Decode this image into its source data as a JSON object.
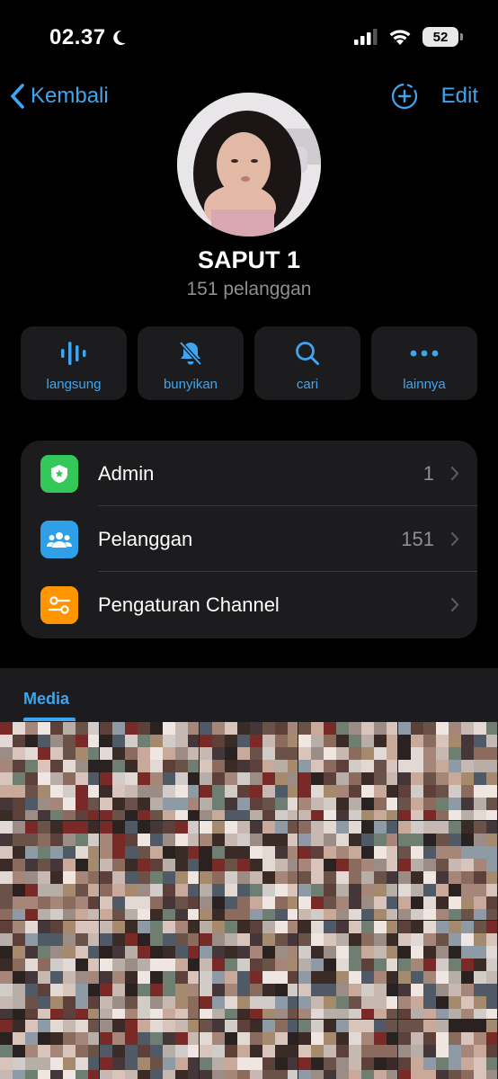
{
  "status_bar": {
    "time": "02.37",
    "moon_icon": "moon-icon",
    "battery": "52"
  },
  "nav": {
    "back_label": "Kembali",
    "edit_label": "Edit",
    "add_icon": "plus-circle-icon"
  },
  "profile": {
    "name": "SAPUT 1",
    "subscribers": "151 pelanggan"
  },
  "actions": [
    {
      "label": "langsung",
      "icon": "live-waveform-icon"
    },
    {
      "label": "bunyikan",
      "icon": "bell-slash-icon"
    },
    {
      "label": "cari",
      "icon": "search-icon"
    },
    {
      "label": "lainnya",
      "icon": "more-icon"
    }
  ],
  "settings": [
    {
      "label": "Admin",
      "value": "1",
      "icon": "shield-star-icon",
      "color": "#34c759"
    },
    {
      "label": "Pelanggan",
      "value": "151",
      "icon": "people-icon",
      "color": "#2f9fe8"
    },
    {
      "label": "Pengaturan Channel",
      "value": "",
      "icon": "sliders-icon",
      "color": "#ff9500"
    }
  ],
  "media": {
    "tab_label": "Media"
  },
  "colors": {
    "accent": "#3ea6f0",
    "background": "#000000",
    "card": "#1c1c1e"
  }
}
